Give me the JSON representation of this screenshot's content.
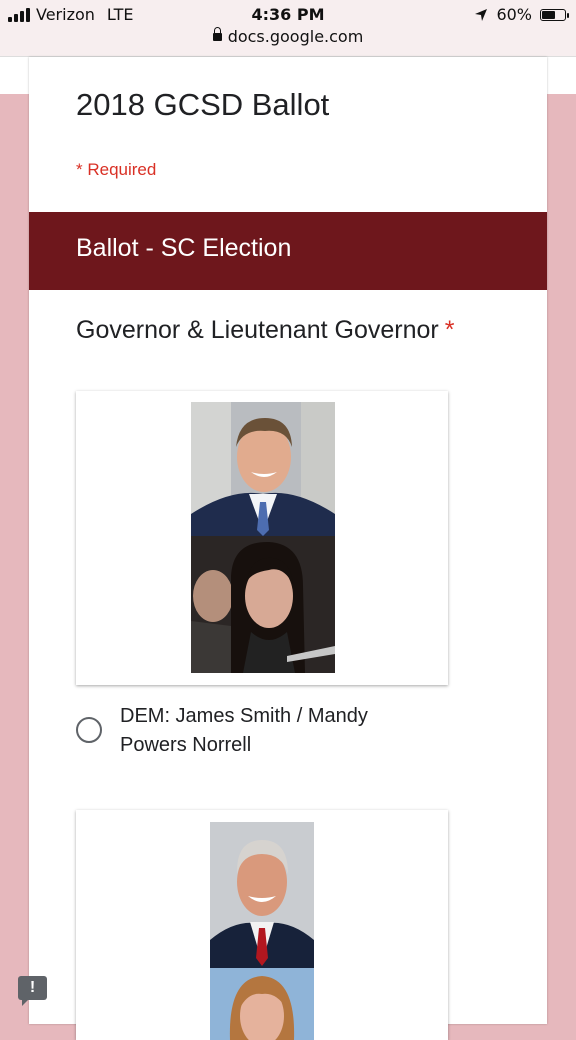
{
  "status_bar": {
    "carrier": "Verizon",
    "network": "LTE",
    "time": "4:36 PM",
    "url": "docs.google.com",
    "battery": "60%",
    "battery_level": 0.6
  },
  "form": {
    "title": "2018 GCSD Ballot",
    "required_note": "* Required",
    "section_title": "Ballot - SC Election",
    "question": {
      "title": "Governor & Lieutenant Governor",
      "required_mark": "*",
      "options": [
        {
          "label": "DEM: James Smith / Mandy Powers Norrell"
        }
      ]
    }
  },
  "icons": {
    "location": "location-arrow-icon",
    "lock": "lock-icon",
    "feedback": "report-problem-icon"
  },
  "colors": {
    "banner": "#6e171c",
    "required": "#d93025",
    "background": "#e6b8bd"
  },
  "feedback_glyph": "!"
}
